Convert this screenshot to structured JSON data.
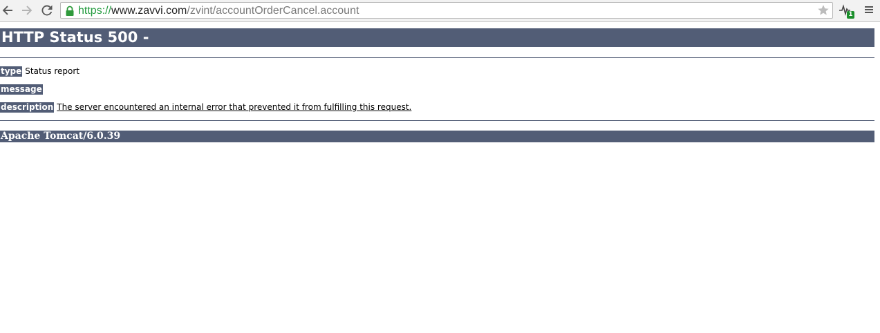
{
  "browser": {
    "url": {
      "scheme": "https://",
      "host": "www.zavvi.com",
      "path": "/zvint/accountOrderCancel.account"
    },
    "extension_badge": "1",
    "icons": {
      "back": "back-arrow-icon",
      "forward": "forward-arrow-icon",
      "reload": "reload-icon",
      "lock": "lock-icon",
      "star": "star-icon",
      "extension": "pulse-extension-icon",
      "menu": "hamburger-menu-icon"
    },
    "colors": {
      "secure_scheme": "#239b3f",
      "badge": "#1b8f2b"
    }
  },
  "page": {
    "heading": "HTTP Status 500 -",
    "type_label": "type",
    "type_value": "Status report",
    "message_label": "message",
    "message_value": "",
    "description_label": "description",
    "description_value": "The server encountered an internal error that prevented it from fulfilling this request.",
    "footer": "Apache Tomcat/6.0.39",
    "colors": {
      "accent": "#525d76"
    }
  }
}
